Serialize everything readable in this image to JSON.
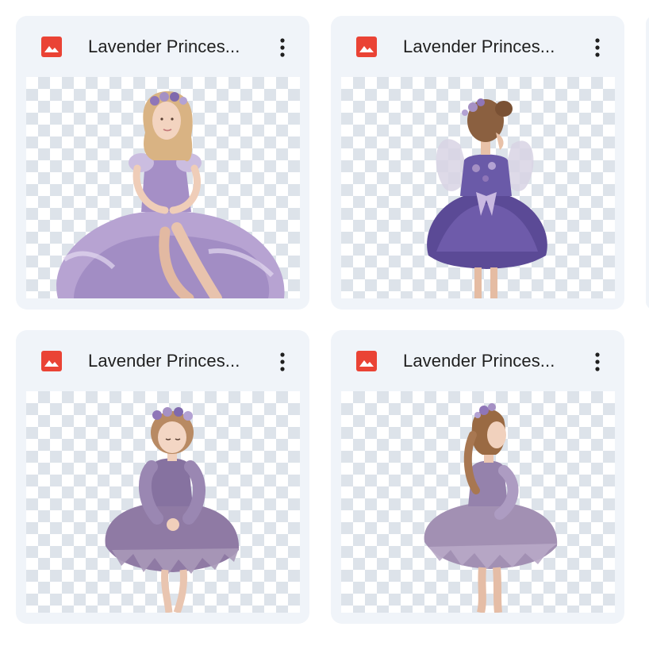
{
  "files": [
    {
      "name": "Lavender Princes...",
      "icon": "image-icon",
      "menu_icon": "more-vert-icon",
      "thumbnail": "girl-sitting-lavender-gown"
    },
    {
      "name": "Lavender Princes...",
      "icon": "image-icon",
      "menu_icon": "more-vert-icon",
      "thumbnail": "girl-back-fairy-wings-dress"
    },
    {
      "name": "Lavender Princes...",
      "icon": "image-icon",
      "menu_icon": "more-vert-icon",
      "thumbnail": "girl-flower-crown-tutu"
    },
    {
      "name": "Lavender Princes...",
      "icon": "image-icon",
      "menu_icon": "more-vert-icon",
      "thumbnail": "girl-profile-tutu-dress"
    }
  ],
  "colors": {
    "card_background": "#f0f4f9",
    "image_icon_red": "#ea4335",
    "text": "#1f1f1f",
    "lavender": "#a590c4",
    "deep_violet": "#5b4a96"
  }
}
